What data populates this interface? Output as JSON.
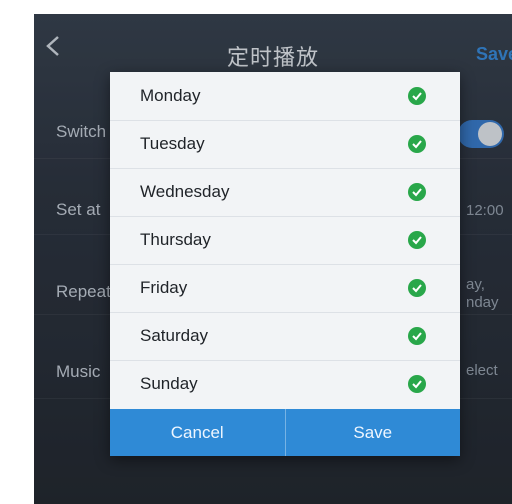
{
  "header": {
    "title": "定时播放",
    "save_label": "Save"
  },
  "background": {
    "rows": [
      {
        "label": "Switch",
        "value": ""
      },
      {
        "label": "Set at",
        "value": "12:00"
      },
      {
        "label": "Repeat",
        "value": "ay, nday"
      },
      {
        "label": "Music",
        "value": "elect"
      }
    ]
  },
  "dialog": {
    "days": [
      {
        "label": "Monday",
        "checked": true
      },
      {
        "label": "Tuesday",
        "checked": true
      },
      {
        "label": "Wednesday",
        "checked": true
      },
      {
        "label": "Thursday",
        "checked": true
      },
      {
        "label": "Friday",
        "checked": true
      },
      {
        "label": "Saturday",
        "checked": true
      },
      {
        "label": "Sunday",
        "checked": true
      }
    ],
    "cancel_label": "Cancel",
    "save_label": "Save"
  },
  "colors": {
    "accent": "#2f8ad6",
    "check": "#29a74a"
  }
}
